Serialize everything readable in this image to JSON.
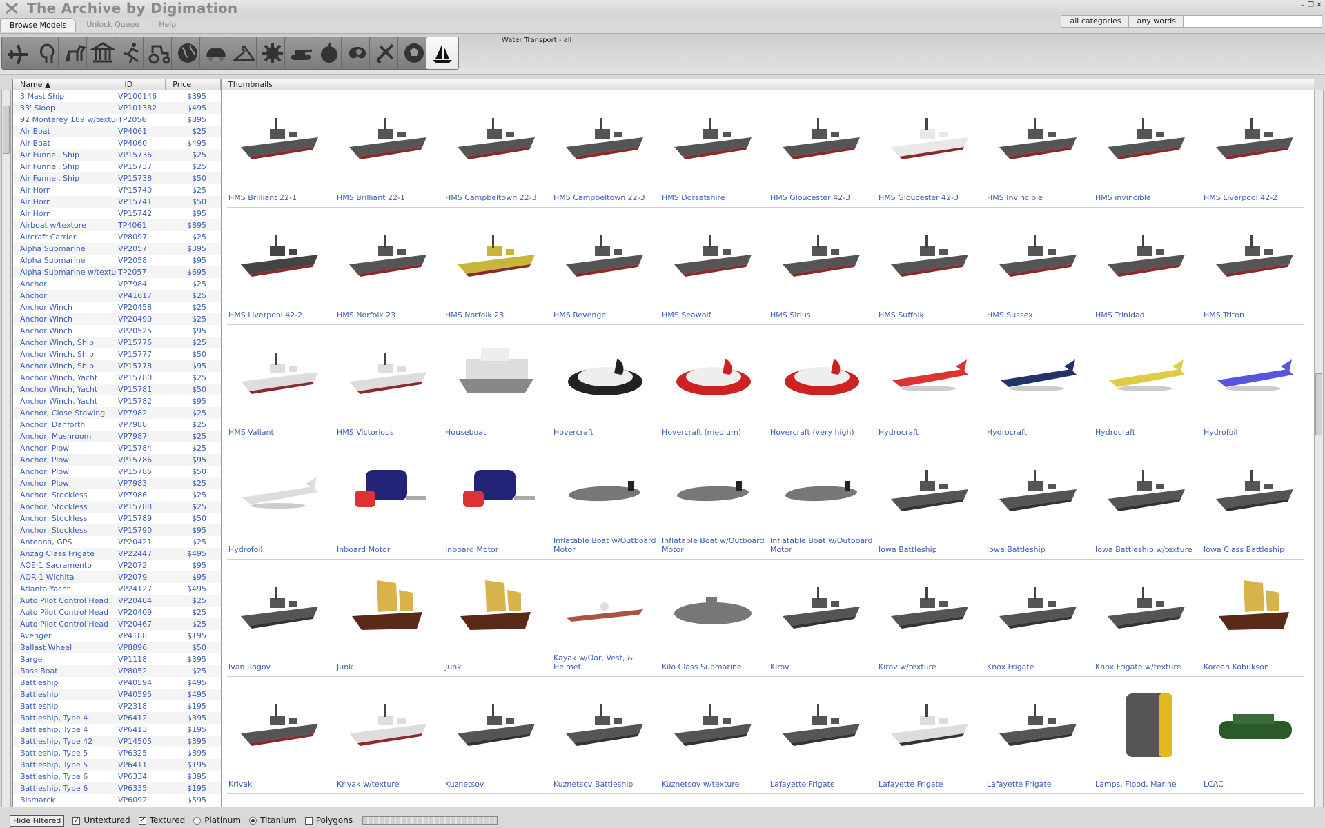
{
  "app": {
    "title": "The Archive by Digimation"
  },
  "tabs": [
    {
      "label": "Browse Models",
      "active": true
    },
    {
      "label": "Unlock Queue",
      "active": false
    },
    {
      "label": "Help",
      "active": false
    }
  ],
  "search": {
    "category": "all categories",
    "match": "any words",
    "query": ""
  },
  "categories": [
    {
      "icon": "airplane-icon"
    },
    {
      "icon": "head-icon"
    },
    {
      "icon": "horse-icon"
    },
    {
      "icon": "building-icon"
    },
    {
      "icon": "runner-icon"
    },
    {
      "icon": "tractor-icon"
    },
    {
      "icon": "globe-icon"
    },
    {
      "icon": "car-icon"
    },
    {
      "icon": "hanger-icon"
    },
    {
      "icon": "gear-icon"
    },
    {
      "icon": "tank-icon"
    },
    {
      "icon": "fruit-icon"
    },
    {
      "icon": "abstract-icon"
    },
    {
      "icon": "tools-icon"
    },
    {
      "icon": "soccer-ball-icon"
    },
    {
      "icon": "sailboat-icon",
      "active": true
    }
  ],
  "category_caption": "Water Transport - all",
  "list": {
    "headers": {
      "name": "Name",
      "id": "ID",
      "price": "Price"
    },
    "rows": [
      [
        "3 Mast Ship",
        "VP100146",
        "$395"
      ],
      [
        "33' Sloop",
        "VP101382",
        "$495"
      ],
      [
        "92 Monterey 189 w/texture",
        "TP2056",
        "$895"
      ],
      [
        "Air Boat",
        "VP4061",
        "$25"
      ],
      [
        "Air Boat",
        "VP4060",
        "$495"
      ],
      [
        "Air Funnel, Ship",
        "VP15736",
        "$25"
      ],
      [
        "Air Funnel, Ship",
        "VP15737",
        "$25"
      ],
      [
        "Air Funnel, Ship",
        "VP15738",
        "$50"
      ],
      [
        "Air Horn",
        "VP15740",
        "$25"
      ],
      [
        "Air Horn",
        "VP15741",
        "$50"
      ],
      [
        "Air Horn",
        "VP15742",
        "$95"
      ],
      [
        "Airboat w/texture",
        "TP4061",
        "$895"
      ],
      [
        "Aircraft Carrier",
        "VP8097",
        "$25"
      ],
      [
        "Alpha Submarine",
        "VP2057",
        "$395"
      ],
      [
        "Alpha Submarine",
        "VP2058",
        "$95"
      ],
      [
        "Alpha Submarine w/texture",
        "TP2057",
        "$695"
      ],
      [
        "Anchor",
        "VP7984",
        "$25"
      ],
      [
        "Anchor",
        "VP41617",
        "$25"
      ],
      [
        "Anchor Winch",
        "VP20458",
        "$25"
      ],
      [
        "Anchor Winch",
        "VP20490",
        "$25"
      ],
      [
        "Anchor Winch",
        "VP20525",
        "$95"
      ],
      [
        "Anchor Winch, Ship",
        "VP15776",
        "$25"
      ],
      [
        "Anchor Winch, Ship",
        "VP15777",
        "$50"
      ],
      [
        "Anchor Winch, Ship",
        "VP15778",
        "$95"
      ],
      [
        "Anchor Winch, Yacht",
        "VP15780",
        "$25"
      ],
      [
        "Anchor Winch, Yacht",
        "VP15781",
        "$50"
      ],
      [
        "Anchor Winch, Yacht",
        "VP15782",
        "$95"
      ],
      [
        "Anchor, Close Stowing",
        "VP7982",
        "$25"
      ],
      [
        "Anchor, Danforth",
        "VP7988",
        "$25"
      ],
      [
        "Anchor, Mushroom",
        "VP7987",
        "$25"
      ],
      [
        "Anchor, Plow",
        "VP15784",
        "$25"
      ],
      [
        "Anchor, Plow",
        "VP15786",
        "$95"
      ],
      [
        "Anchor, Plow",
        "VP15785",
        "$50"
      ],
      [
        "Anchor, Plow",
        "VP7983",
        "$25"
      ],
      [
        "Anchor, Stockless",
        "VP7986",
        "$25"
      ],
      [
        "Anchor, Stockless",
        "VP15788",
        "$25"
      ],
      [
        "Anchor, Stockless",
        "VP15789",
        "$50"
      ],
      [
        "Anchor, Stockless",
        "VP15790",
        "$95"
      ],
      [
        "Antenna, GPS",
        "VP20421",
        "$25"
      ],
      [
        "Anzag Class Frigate",
        "VP22447",
        "$495"
      ],
      [
        "AOE-1 Sacramento",
        "VP2072",
        "$95"
      ],
      [
        "AOR-1 Wichita",
        "VP2079",
        "$95"
      ],
      [
        "Atlanta Yacht",
        "VP24127",
        "$495"
      ],
      [
        "Auto Pilot Control Head",
        "VP20404",
        "$25"
      ],
      [
        "Auto Pilot Control Head",
        "VP20409",
        "$25"
      ],
      [
        "Auto Pilot Control Head",
        "VP20467",
        "$25"
      ],
      [
        "Avenger",
        "VP4188",
        "$195"
      ],
      [
        "Ballast Wheel",
        "VP8896",
        "$50"
      ],
      [
        "Barge",
        "VP1118",
        "$395"
      ],
      [
        "Bass Boat",
        "VP8052",
        "$25"
      ],
      [
        "Battleship",
        "VP40594",
        "$495"
      ],
      [
        "Battleship",
        "VP40595",
        "$495"
      ],
      [
        "Battleship",
        "VP2318",
        "$195"
      ],
      [
        "Battleship, Type 4",
        "VP6412",
        "$395"
      ],
      [
        "Battleship, Type 4",
        "VP6413",
        "$195"
      ],
      [
        "Battleship, Type 42",
        "VP14505",
        "$395"
      ],
      [
        "Battleship, Type 5",
        "VP6325",
        "$395"
      ],
      [
        "Battleship, Type 5",
        "VP6411",
        "$195"
      ],
      [
        "Battleship, Type 6",
        "VP6334",
        "$395"
      ],
      [
        "Battleship, Type 6",
        "VP6335",
        "$195"
      ],
      [
        "Bismarck",
        "VP6092",
        "$595"
      ]
    ]
  },
  "thumbnails": {
    "header": "Thumbnails",
    "rows": [
      [
        "HMS Brilliant 22-1",
        "HMS Brilliant 22-1",
        "HMS Campbeltown 22-3",
        "HMS Campbeltown 22-3",
        "HMS Dorsetshire",
        "HMS Gloucester 42-3",
        "HMS Gloucester 42-3",
        "HMS Invincible",
        "HMS invincible",
        "HMS Liverpool 42-2"
      ],
      [
        "HMS Liverpool 42-2",
        "HMS Norfolk 23",
        "HMS Norfolk 23",
        "HMS Revenge",
        "HMS Seawolf",
        "HMS Sirius",
        "HMS Suffolk",
        "HMS Sussex",
        "HMS Trinidad",
        "HMS Triton"
      ],
      [
        "HMS Valiant",
        "HMS Victorious",
        "Houseboat",
        "Hovercraft",
        "Hovercraft (medium)",
        "Hovercraft (very high)",
        "Hydrocraft",
        "Hydrocraft",
        "Hydrocraft",
        "Hydrofoil"
      ],
      [
        "Hydrofoil",
        "Inboard Motor",
        "Inboard Motor",
        "Inflatable Boat w/Outboard Motor",
        "Inflatable Boat w/Outboard Motor",
        "Inflatable Boat w/Outboard Motor",
        "Iowa Battleship",
        "Iowa Battleship",
        "Iowa Battleship w/texture",
        "Iowa Class Battleship"
      ],
      [
        "Ivan Rogov",
        "Junk",
        "Junk",
        "Kayak w/Oar, Vest, & Helmet",
        "Kilo Class Submarine",
        "Kirov",
        "Kirov w/texture",
        "Knox Frigate",
        "Knox Frigate w/texture",
        "Korean Kobukson"
      ],
      [
        "Krivak",
        "Krivak w/texture",
        "Kuznetsov",
        "Kuznetsov Battleship",
        "Kuznetsov w/texture",
        "Lafayette Frigate",
        "Lafayette Frigate",
        "Lafayette Frigate",
        "Lamps, Flood, Marine",
        "LCAC"
      ]
    ]
  },
  "statusbar": {
    "hide_filtered": "Hide Filtered",
    "untextured": "Untextured",
    "textured": "Textured",
    "platinum": "Platinum",
    "titanium": "Titanium",
    "polygons": "Polygons"
  }
}
